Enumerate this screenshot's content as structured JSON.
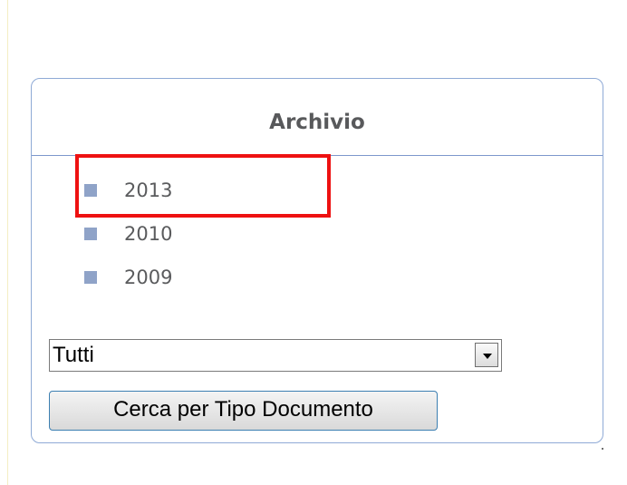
{
  "archive_panel": {
    "title": "Archivio",
    "years": [
      {
        "label": "2013",
        "highlighted": true
      },
      {
        "label": "2010",
        "highlighted": false
      },
      {
        "label": "2009",
        "highlighted": false
      }
    ],
    "doc_type_select": {
      "selected": "Tutti"
    },
    "search_button_label": "Cerca per Tipo Documento"
  },
  "colors": {
    "panel_border": "#8faad6",
    "bullet": "#8fa3c8",
    "highlight": "#ee1111",
    "button_border": "#3c7fb1"
  },
  "icons": {
    "select_arrow": "chevron-down-icon",
    "bullet": "square-bullet-icon"
  }
}
